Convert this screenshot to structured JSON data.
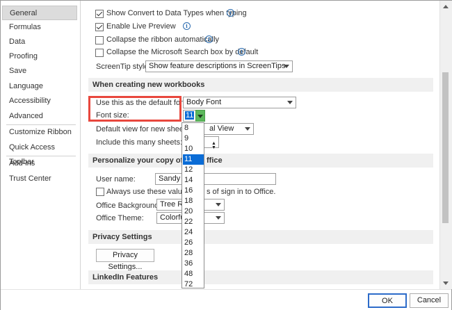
{
  "sidebar": {
    "items": [
      {
        "label": "General",
        "selected": true
      },
      {
        "label": "Formulas"
      },
      {
        "label": "Data"
      },
      {
        "label": "Proofing"
      },
      {
        "label": "Save"
      },
      {
        "label": "Language"
      },
      {
        "label": "Accessibility"
      },
      {
        "label": "Advanced"
      },
      {
        "label": "Customize Ribbon"
      },
      {
        "label": "Quick Access Toolbar"
      },
      {
        "label": "Add-ins"
      },
      {
        "label": "Trust Center"
      }
    ]
  },
  "ui_options": {
    "show_convert": {
      "label": "Show Convert to Data Types when typing",
      "checked": true
    },
    "live_preview": {
      "label": "Enable Live Preview",
      "checked": true
    },
    "collapse_ribbon": {
      "label": "Collapse the ribbon automatically",
      "checked": false
    },
    "collapse_search": {
      "label": "Collapse the Microsoft Search box by default",
      "checked": false
    },
    "screentip_label": "ScreenTip style:",
    "screentip_value": "Show feature descriptions in ScreenTips",
    "info_glyph": "i"
  },
  "new_workbooks": {
    "header": "When creating new workbooks",
    "default_font_label": "Use this as the default font:",
    "default_font_value": "Body Font",
    "font_size_label": "Font size:",
    "font_size_value": "11",
    "default_view_label": "Default view for new sheets:",
    "default_view_value": "al View",
    "sheets_label": "Include this many sheets:"
  },
  "font_size_options": [
    "8",
    "9",
    "10",
    "11",
    "12",
    "14",
    "16",
    "18",
    "20",
    "22",
    "24",
    "26",
    "28",
    "36",
    "48",
    "72"
  ],
  "font_size_selected": "11",
  "personalize": {
    "header_left": "Personalize your copy of Micr",
    "header_right": "ffice",
    "username_label": "User name:",
    "username_value": "Sandy",
    "always_use_left": "Always use these values re",
    "always_use_right": "s of sign in to Office.",
    "background_label": "Office Background:",
    "background_value": "Tree Ri",
    "theme_label": "Office Theme:",
    "theme_value": "Colorfu"
  },
  "privacy": {
    "header": "Privacy Settings",
    "button": "Privacy Settings..."
  },
  "linkedin": {
    "header": "LinkedIn Features"
  },
  "footer": {
    "ok": "OK",
    "cancel": "Cancel"
  },
  "colors": {
    "highlight": "#e8473d",
    "selection": "#0a6cd6",
    "dropdown_button": "#5cb85c"
  }
}
